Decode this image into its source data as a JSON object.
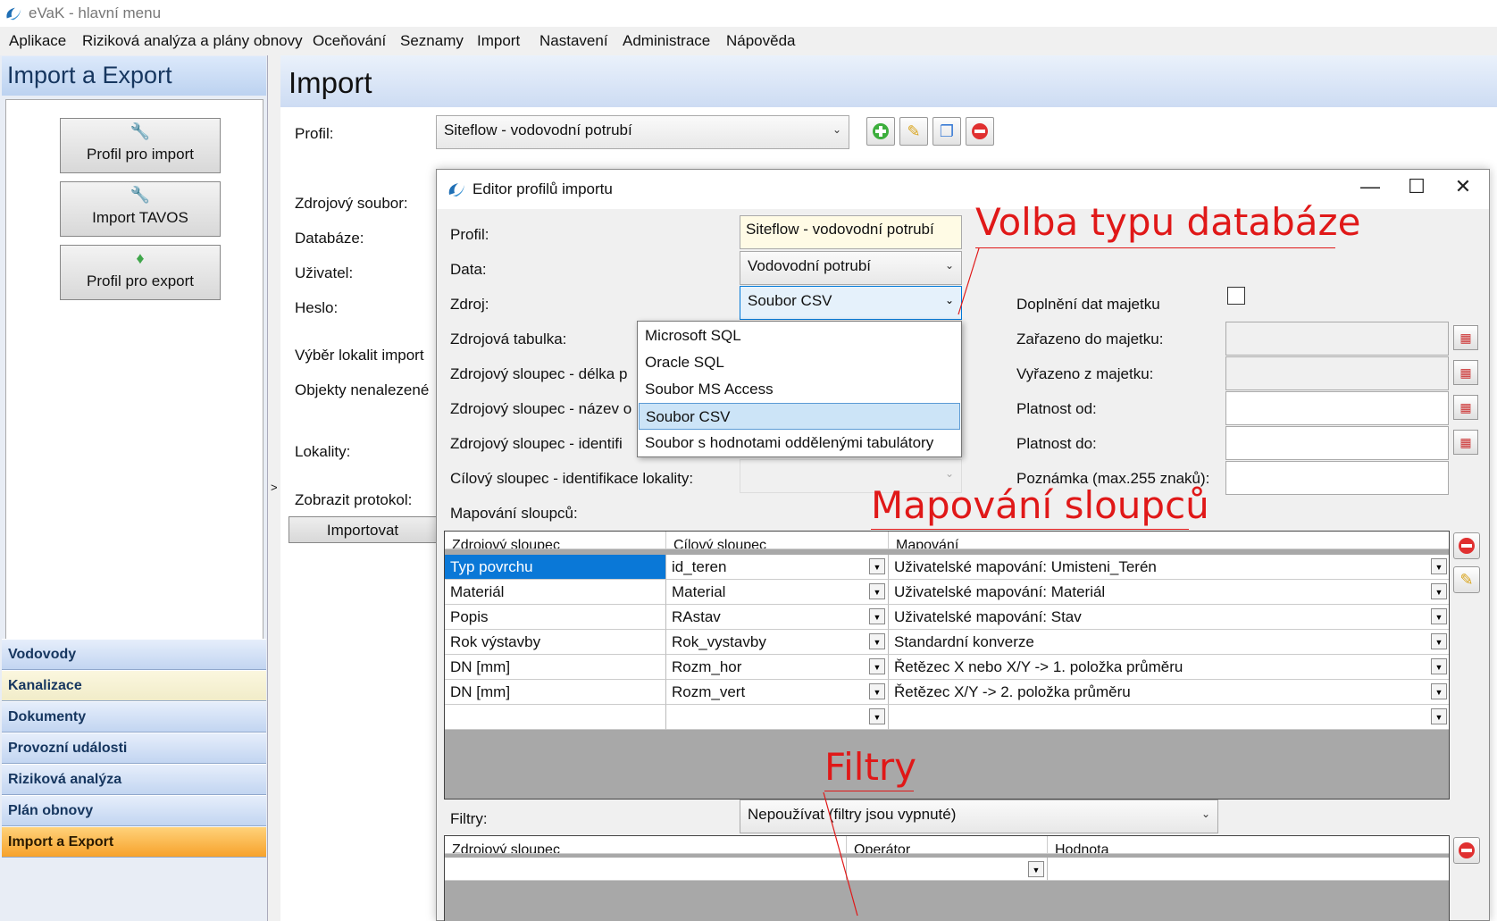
{
  "window": {
    "title": "eVaK - hlavní menu"
  },
  "menu": [
    "Aplikace",
    "Riziková analýza a plány obnovy",
    "Oceňování",
    "Seznamy",
    "Import",
    "Nastavení",
    "Administrace",
    "Nápověda"
  ],
  "left_panel": {
    "title": "Import a Export",
    "buttons": [
      {
        "label": "Profil pro import",
        "icon": "wrench-icon"
      },
      {
        "label": "Import TAVOS",
        "icon": "wrench-icon"
      },
      {
        "label": "Profil pro export",
        "icon": "export-icon"
      }
    ],
    "nav": [
      "Vodovody",
      "Kanalizace",
      "Dokumenty",
      "Provozní události",
      "Riziková analýza",
      "Plán obnovy",
      "Import a Export"
    ]
  },
  "splitter_glyph": ">",
  "main": {
    "title": "Import",
    "profile_label": "Profil:",
    "profile_value": "Siteflow - vodovodní potrubí",
    "labels": [
      "Zdrojový soubor:",
      "Databáze:",
      "Uživatel:",
      "Heslo:",
      "Výběr lokalit import",
      "Objekty nenalezené",
      "Lokality:",
      "Zobrazit protokol:"
    ],
    "import_button": "Importovat"
  },
  "dialog": {
    "title": "Editor profilů importu",
    "profile_label": "Profil:",
    "profile_value": "Siteflow - vodovodní potrubí",
    "data_label": "Data:",
    "data_value": "Vodovodní potrubí",
    "source_label": "Zdroj:",
    "source_value": "Soubor CSV",
    "left_labels": [
      "Zdrojová tabulka:",
      "Zdrojový sloupec - délka p",
      "Zdrojový sloupec - název o",
      "Zdrojový sloupec - identifi",
      "Cílový sloupec - identifikace lokality:",
      "Mapování sloupců:"
    ],
    "source_options": [
      "Microsoft SQL",
      "Oracle SQL",
      "Soubor MS Access",
      "Soubor CSV",
      "Soubor s hodnotami oddělenými tabulátory"
    ],
    "source_selected_index": 3,
    "right_labels": [
      "Doplnění dat majetku",
      "Zařazeno do majetku:",
      "Vyřazeno z majetku:",
      "Platnost od:",
      "Platnost do:",
      "Poznámka (max.255 znaků):"
    ],
    "doplneni_checked": false,
    "mapping": {
      "headers": [
        "Zdrojový sloupec",
        "Cílový sloupec",
        "Mapování"
      ],
      "rows": [
        [
          "Typ povrchu",
          "id_teren",
          "Uživatelské mapování: Umisteni_Terén"
        ],
        [
          "Materiál",
          "Material",
          "Uživatelské mapování: Materiál"
        ],
        [
          "Popis",
          "RAstav",
          "Uživatelské mapování: Stav"
        ],
        [
          "Rok výstavby",
          "Rok_vystavby",
          "Standardní konverze"
        ],
        [
          "DN [mm]",
          "Rozm_hor",
          "Řetězec X nebo X/Y -> 1. položka průměru"
        ],
        [
          "DN [mm]",
          "Rozm_vert",
          "Řetězec X/Y -> 2. položka průměru"
        ],
        [
          "",
          "",
          ""
        ]
      ]
    },
    "filters_label": "Filtry:",
    "filters_value": "Nepoužívat (filtry jsou vypnuté)",
    "filters_grid": {
      "headers": [
        "Zdrojový sloupec",
        "Operátor",
        "Hodnota"
      ]
    }
  },
  "annotations": {
    "db_type": "Volba typu databáze",
    "mapping": "Mapování sloupců",
    "filters": "Filtry"
  },
  "colors": {
    "annotation": "#e01818",
    "active_nav": "#f7a22b",
    "selection": "#0a78d7"
  }
}
